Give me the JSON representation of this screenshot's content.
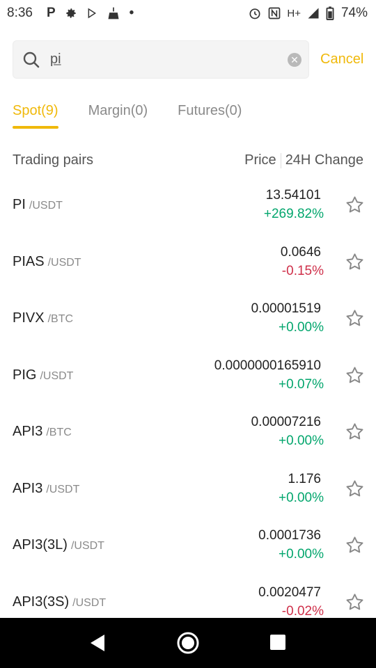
{
  "status_bar": {
    "time": "8:36",
    "network": "H+",
    "battery": "74%",
    "left_icons": [
      "p-icon",
      "gear-icon",
      "play-store-icon",
      "broom-icon",
      "dot-icon"
    ],
    "right_icons": [
      "alarm-icon",
      "nfc-icon",
      "signal-icon",
      "battery-icon"
    ]
  },
  "search": {
    "value": "pi",
    "cancel_label": "Cancel"
  },
  "tabs": [
    {
      "label": "Spot(9)",
      "active": true
    },
    {
      "label": "Margin(0)",
      "active": false
    },
    {
      "label": "Futures(0)",
      "active": false
    }
  ],
  "columns": {
    "pairs": "Trading pairs",
    "price": "Price",
    "change": "24H Change"
  },
  "colors": {
    "accent": "#f0b90b",
    "positive": "#03a66d",
    "negative": "#cf304a"
  },
  "pairs": [
    {
      "base": "PI",
      "quote": "/USDT",
      "price": "13.54101",
      "change": "+269.82%",
      "direction": "pos"
    },
    {
      "base": "PIAS",
      "quote": "/USDT",
      "price": "0.0646",
      "change": "-0.15%",
      "direction": "neg"
    },
    {
      "base": "PIVX",
      "quote": "/BTC",
      "price": "0.00001519",
      "change": "+0.00%",
      "direction": "pos"
    },
    {
      "base": "PIG",
      "quote": "/USDT",
      "price": "0.0000000165910",
      "change": "+0.07%",
      "direction": "pos"
    },
    {
      "base": "API3",
      "quote": "/BTC",
      "price": "0.00007216",
      "change": "+0.00%",
      "direction": "pos"
    },
    {
      "base": "API3",
      "quote": "/USDT",
      "price": "1.176",
      "change": "+0.00%",
      "direction": "pos"
    },
    {
      "base": "API3(3L)",
      "quote": "/USDT",
      "price": "0.0001736",
      "change": "+0.00%",
      "direction": "pos"
    },
    {
      "base": "API3(3S)",
      "quote": "/USDT",
      "price": "0.0020477",
      "change": "-0.02%",
      "direction": "neg"
    }
  ],
  "nav": [
    "back-icon",
    "home-icon",
    "recents-icon"
  ]
}
